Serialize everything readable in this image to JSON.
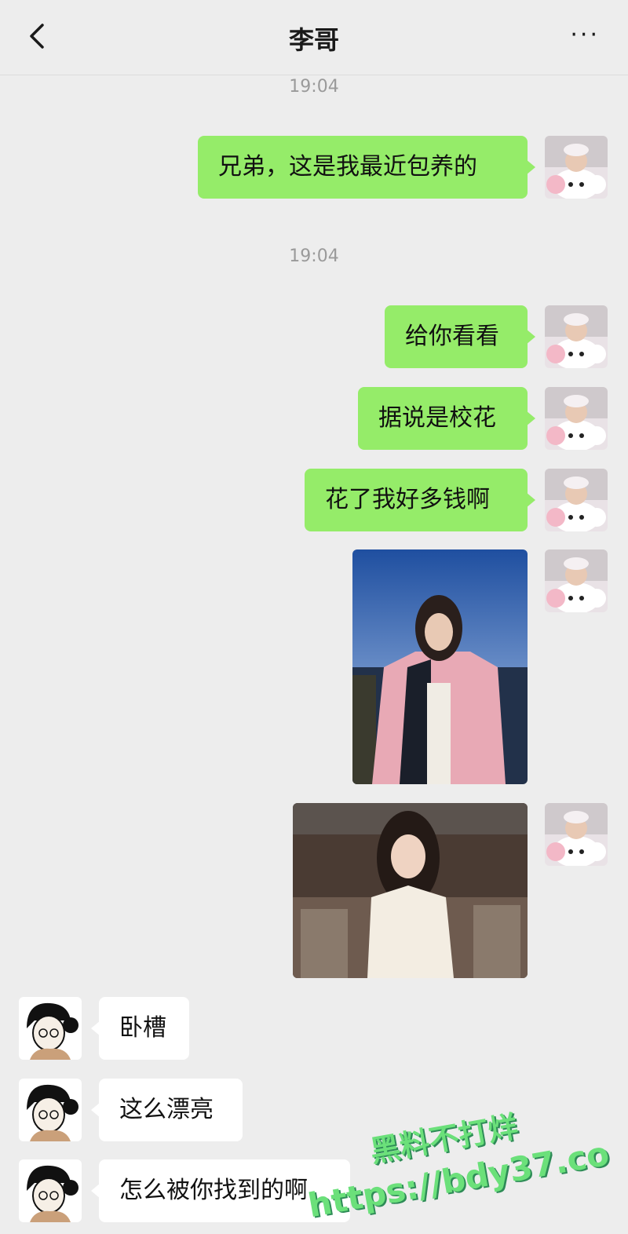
{
  "header": {
    "title": "李哥",
    "back_icon": "chevron-left-icon",
    "more_icon": "more-dots-icon",
    "more_glyph": "···"
  },
  "timestamps": [
    "19:04",
    "19:04"
  ],
  "messages_me": [
    "兄弟，这是我最近包养的",
    "给你看看",
    "据说是校花",
    "花了我好多钱啊"
  ],
  "messages_them": [
    "卧槽",
    "这么漂亮",
    "怎么被你找到的啊"
  ],
  "watermark": {
    "line1": "黑料不打烊",
    "line2": "https://bdy37.co"
  },
  "colors": {
    "bubble_me": "#95ec69",
    "bubble_them": "#ffffff",
    "background": "#ededed",
    "watermark": "#6be07a"
  }
}
